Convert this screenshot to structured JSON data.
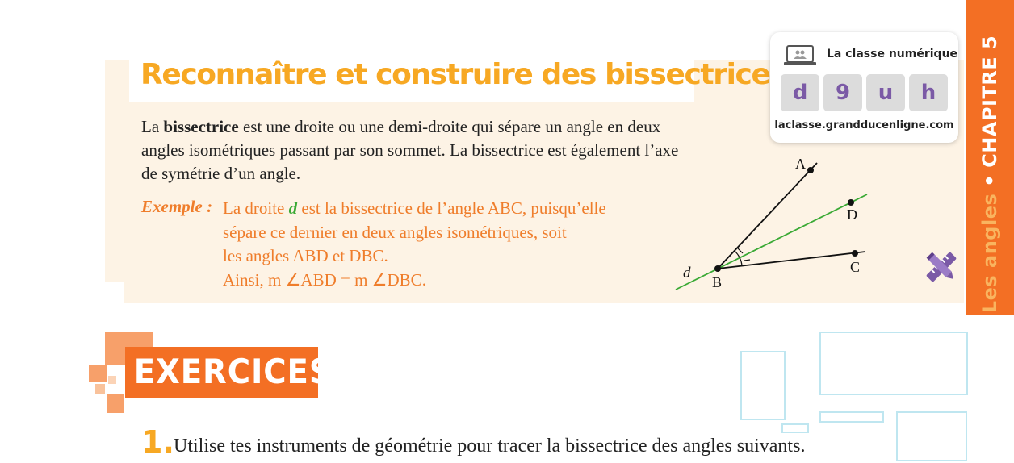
{
  "title": "Reconnaître et construire des bissectrices",
  "definition": {
    "before": "La ",
    "bold": "bissectrice",
    "after": " est une droite ou une demi-droite qui sépare un angle en deux angles isométriques passant par son sommet. La bissectrice est également l’axe de symétrie d’un angle."
  },
  "example": {
    "label": "Exemple :",
    "line1_a": "La droite ",
    "line1_d": "d",
    "line1_b": " est la bissectrice de l’angle ABC, puisqu’elle",
    "line2": "sépare ce dernier en deux angles isométriques, soit",
    "line3": "les angles ABD et DBC.",
    "line4": "Ainsi, m ∠ABD = m ∠DBC."
  },
  "figure": {
    "point_a": "A",
    "point_b": "B",
    "point_c": "C",
    "point_d": "D",
    "line_label": "d",
    "colors": {
      "bisector": "#3aa935",
      "rays": "#111111"
    }
  },
  "digital_card": {
    "title": "La classe numérique",
    "code": [
      "d",
      "9",
      "u",
      "h"
    ],
    "url": "laclasse.grandducenligne.com",
    "icon": "laptop-icon"
  },
  "side_tab": {
    "chapter": "CHAPITRE 5",
    "separator": "•",
    "theme": "Les angles"
  },
  "exercises": {
    "banner": "EXERCICES",
    "q1_number": "1.",
    "q1_text": "Utilise tes instruments de géométrie pour tracer la bissectrice des angles suivants."
  },
  "colors": {
    "orange": "#f36f24",
    "yellow": "#f7a823",
    "cream": "#fdf3e5",
    "purple": "#7b5aa6",
    "green": "#3aa935"
  }
}
